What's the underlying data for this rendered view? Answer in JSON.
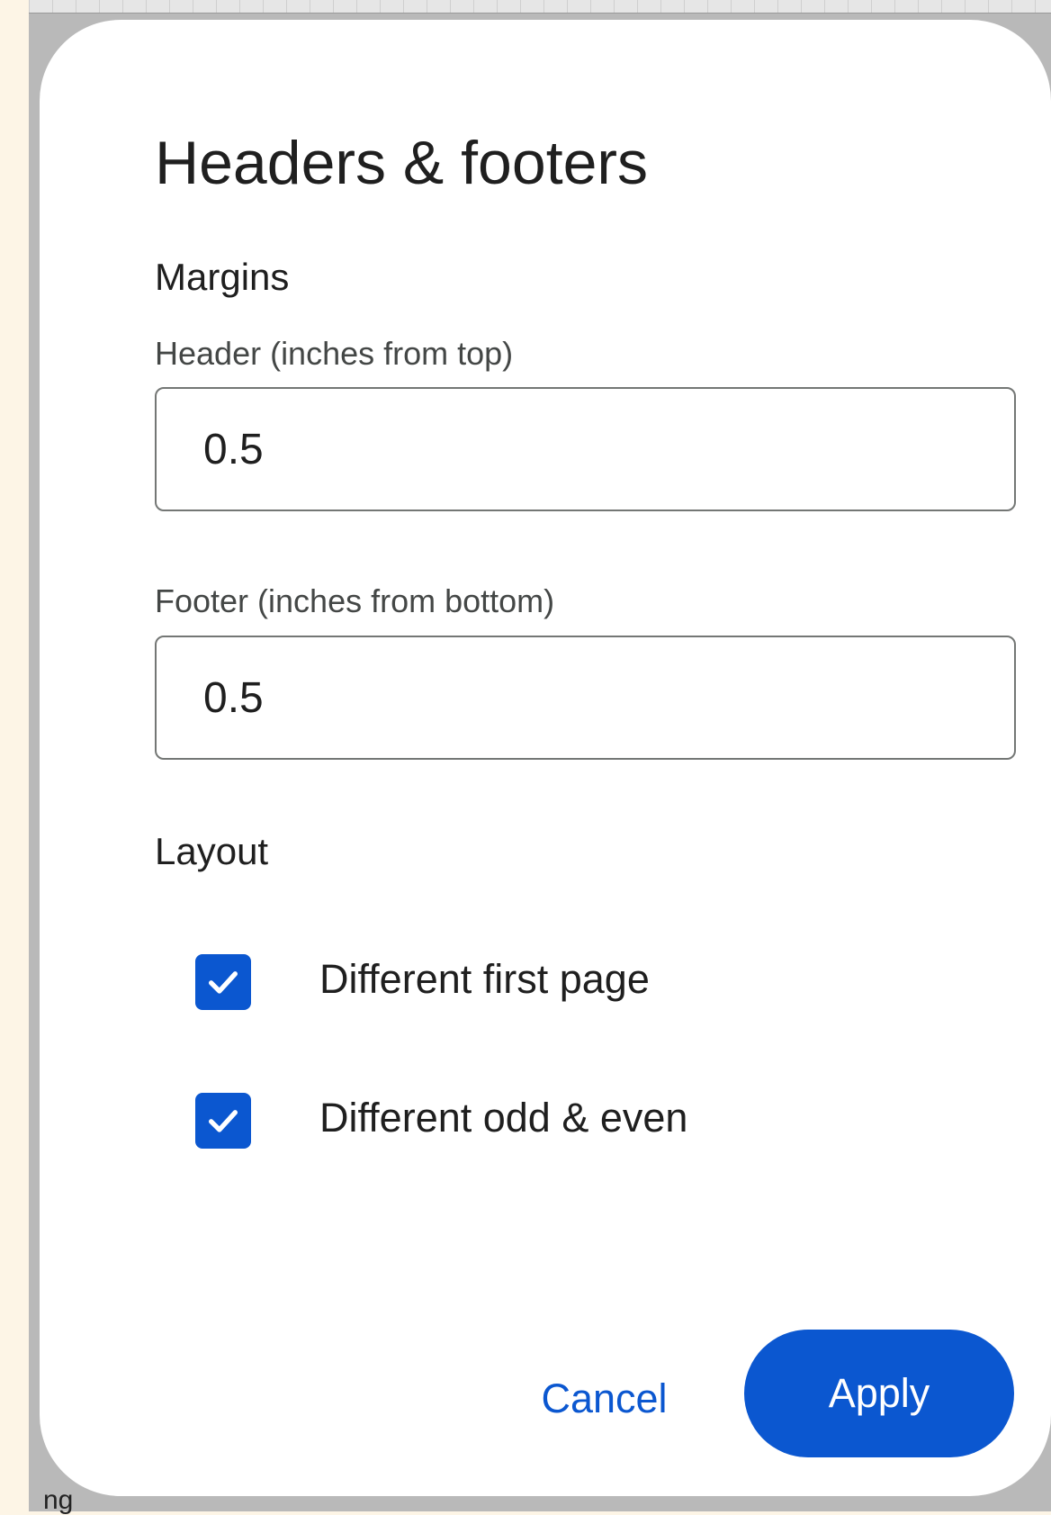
{
  "background": {
    "doc_text_fragment": "ng"
  },
  "dialog": {
    "title": "Headers & footers",
    "margins_heading": "Margins",
    "header_field": {
      "label": "Header (inches from top)",
      "value": "0.5"
    },
    "footer_field": {
      "label": "Footer (inches from bottom)",
      "value": "0.5"
    },
    "layout_heading": "Layout",
    "checkboxes": [
      {
        "label": "Different first page",
        "checked": true
      },
      {
        "label": "Different odd & even",
        "checked": true
      }
    ],
    "buttons": {
      "cancel": "Cancel",
      "apply": "Apply"
    }
  },
  "colors": {
    "accent": "#0b57d0",
    "text_primary": "#1f1f1f",
    "text_secondary": "#444746",
    "field_border": "#747775",
    "page_background": "#fdf5e6"
  },
  "icons": {
    "checkbox_check": "check-icon"
  }
}
